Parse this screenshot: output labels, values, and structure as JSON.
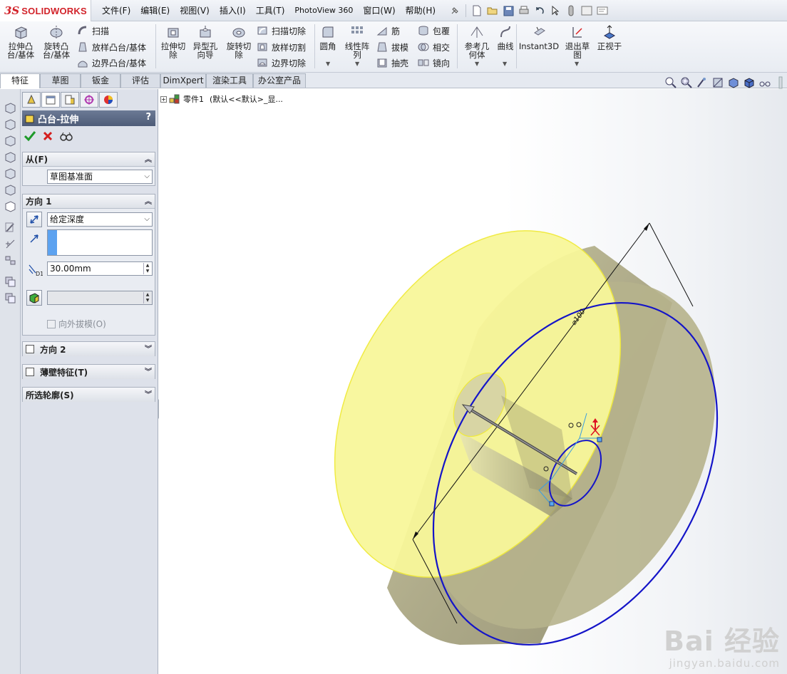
{
  "app": {
    "logo_mark": "3S",
    "logo_name": "SOLIDWORKS"
  },
  "menu": [
    "文件(F)",
    "编辑(E)",
    "视图(V)",
    "插入(I)",
    "工具(T)",
    "PhotoView 360",
    "窗口(W)",
    "帮助(H)"
  ],
  "toolbar": {
    "extrude_boss": [
      "拉伸凸",
      "台/基体"
    ],
    "revolve_boss": [
      "旋转凸",
      "台/基体"
    ],
    "sweep": "扫描",
    "loft_boss": "放样凸台/基体",
    "boundary_boss": "边界凸台/基体",
    "extrude_cut": [
      "拉伸切",
      "除"
    ],
    "hole_wizard": [
      "异型孔",
      "向导"
    ],
    "revolve_cut": [
      "旋转切",
      "除"
    ],
    "sweep_cut": "扫描切除",
    "loft_cut": "放样切割",
    "boundary_cut": "边界切除",
    "fillet": "圆角",
    "linear_pattern": [
      "线性阵",
      "列"
    ],
    "rib": "筋",
    "draft": "拔模",
    "shell": "抽壳",
    "wrap": "包覆",
    "intersect": "相交",
    "mirror": "镜向",
    "ref_geometry": [
      "参考几",
      "何体"
    ],
    "curves": "曲线",
    "instant3d": "Instant3D",
    "exit_sketch": [
      "退出草",
      "图"
    ],
    "normal_to": "正视于"
  },
  "tabs": [
    "特征",
    "草图",
    "钣金",
    "评估",
    "DimXpert",
    "渲染工具",
    "办公室产品"
  ],
  "tree": {
    "root": "零件1",
    "config": "(默认<<默认>_显..."
  },
  "property_manager": {
    "title": "凸台-拉伸",
    "help": "?",
    "from_group": {
      "title": "从(F)",
      "value": "草图基准面"
    },
    "dir1_group": {
      "title": "方向 1",
      "end_condition": "给定深度",
      "depth": "30.00mm",
      "depth_label": "D1",
      "draft_outward": "向外拔模(O)"
    },
    "dir2_title": "方向 2",
    "thin_title": "薄壁特征(T)",
    "contours_title": "所选轮廓(S)"
  },
  "graphics": {
    "dimension_text": "⌀100"
  },
  "watermark": {
    "top": "Bai 经验",
    "bottom": "jingyan.baidu.com"
  },
  "colors": {
    "face_yellow": "#fbfa8c",
    "sketch_blue": "#1414c8",
    "pm_title": "#5a6884"
  }
}
